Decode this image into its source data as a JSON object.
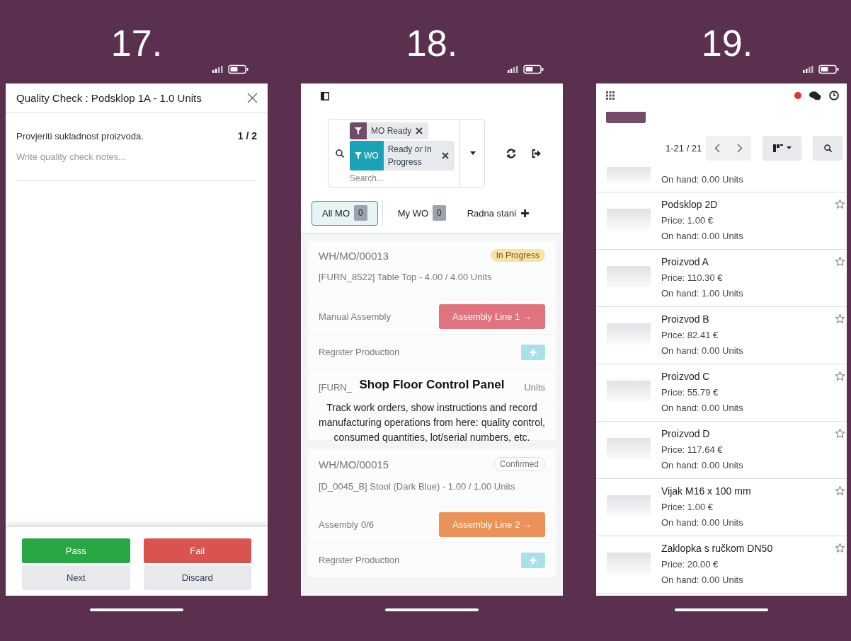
{
  "step_labels": [
    "17.",
    "18.",
    "19."
  ],
  "quality_check": {
    "title": "Quality Check : Podsklop 1A - 1.0 Units",
    "instruction": "Provjeriti sukladnost proizvoda.",
    "progress": "1 / 2",
    "notes": {
      "placeholder": "Write quality check notes..."
    },
    "buttons": [
      {
        "label": "Pass",
        "kind": "pass"
      },
      {
        "label": "Fail",
        "kind": "fail"
      },
      {
        "label": "Next",
        "kind": "plain"
      },
      {
        "label": "Discard",
        "kind": "plain"
      }
    ]
  },
  "shop_floor": {
    "facets": [
      {
        "kind": "icon",
        "label": "MO Ready",
        "color": "#714b67"
      },
      {
        "kind": "text",
        "tag": "WO",
        "label": "Ready *or* In Progress",
        "color": "#1aa3b5"
      }
    ],
    "search": {
      "placeholder": "Search..."
    },
    "tabs": [
      {
        "label": "All MO",
        "count": "0",
        "selected": true
      },
      {
        "label": "My WO",
        "count": "0",
        "selected": false
      },
      {
        "label": "Radna stani",
        "selected": false
      }
    ],
    "orders": [
      {
        "reference": "WH/MO/00013",
        "state": "In Progress",
        "kind": "progress",
        "product": "[FURN_8522] Table Top - 4.00 / 4.00 Units",
        "rows": [
          {
            "kind": "workcenter",
            "label": "Manual Assembly",
            "action": "Assembly Line 1 →",
            "color": "#e0737d"
          },
          {
            "kind": "register",
            "label": "Register Production"
          },
          {
            "kind": "component",
            "label": "[FURN_",
            "value": "Units"
          }
        ]
      },
      {
        "reference": "WH/MO/00015",
        "state": "Confirmed",
        "kind": "confirmed",
        "product": "[D_0045_B] Stool (Dark Blue) - 1.00 / 1.00 Units",
        "rows": [
          {
            "kind": "workcenter",
            "label": "Assembly 0/6",
            "action": "Assembly Line 2 →",
            "color": "#eb9258"
          },
          {
            "kind": "register",
            "label": "Register Production"
          }
        ]
      }
    ],
    "help": {
      "title": "Shop Floor Control Panel",
      "text": "Track work orders, show instructions and record manufacturing operations from here: quality control, consumed quantities, lot/serial numbers, etc."
    }
  },
  "products": {
    "pager": "1-21 / 21",
    "items": [
      {
        "on_hand": "On hand: 0.00 Units"
      },
      {
        "name": "Podsklop 2D",
        "price": "Price: 1.00 €",
        "on_hand": "On hand: 0.00 Units",
        "starred": false
      },
      {
        "name": "Proizvod A",
        "price": "Price: 110.30 €",
        "on_hand": "On hand: 1.00 Units",
        "starred": false
      },
      {
        "name": "Proizvod B",
        "price": "Price: 82.41 €",
        "on_hand": "On hand: 0.00 Units",
        "starred": false
      },
      {
        "name": "Proizvod C",
        "price": "Price: 55.79 €",
        "on_hand": "On hand: 0.00 Units",
        "starred": false
      },
      {
        "name": "Proizvod D",
        "price": "Price: 117.64 €",
        "on_hand": "On hand: 0.00 Units",
        "starred": false
      },
      {
        "name": "Vijak M16 x 100 mm",
        "price": "Price: 1.00 €",
        "on_hand": "On hand: 0.00 Units",
        "starred": false
      },
      {
        "name": "Zaklopka s ručkom DN50",
        "price": "Price: 20.00 €",
        "on_hand": "On hand: 0.00 Units",
        "starred": false
      }
    ]
  }
}
